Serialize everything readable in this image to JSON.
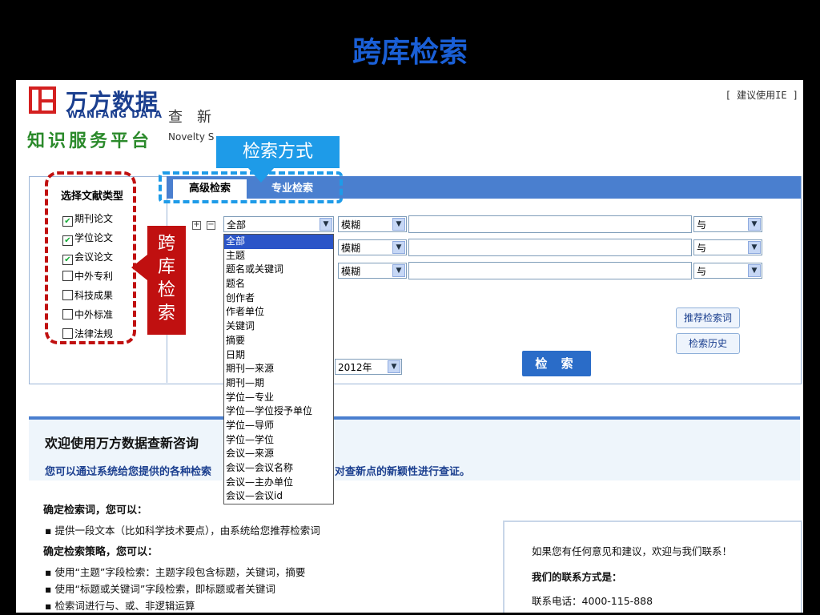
{
  "slide": {
    "title": "跨库检索"
  },
  "header": {
    "logo_cn": "万方数据",
    "logo_en": "WANFANG DATA",
    "platform": "知识服务平台",
    "product_cn": "查新",
    "product_en": "Novelty S",
    "suggest": "[ 建议使用IE ]"
  },
  "callouts": {
    "search_mode": "检索方式",
    "cross_db": [
      "跨",
      "库",
      "检",
      "索"
    ]
  },
  "tabs": [
    {
      "label": "高级检索"
    },
    {
      "label": "专业检索"
    }
  ],
  "doc_types": {
    "title": "选择文献类型",
    "items": [
      {
        "label": "期刊论文",
        "checked": true
      },
      {
        "label": "学位论文",
        "checked": true
      },
      {
        "label": "会议论文",
        "checked": true
      },
      {
        "label": "中外专利",
        "checked": false
      },
      {
        "label": "科技成果",
        "checked": false
      },
      {
        "label": "中外标准",
        "checked": false
      },
      {
        "label": "法律法规",
        "checked": false
      }
    ]
  },
  "search_rows": [
    {
      "field": "全部",
      "match": "模糊",
      "logic": "与"
    },
    {
      "field": "",
      "match": "模糊",
      "logic": "与"
    },
    {
      "field": "",
      "match": "模糊",
      "logic": "与"
    }
  ],
  "field_options": [
    "全部",
    "主题",
    "题名或关键词",
    "题名",
    "创作者",
    "作者单位",
    "关键词",
    "摘要",
    "日期",
    "期刊—来源",
    "期刊—期",
    "学位—专业",
    "学位—学位授予单位",
    "学位—导师",
    "学位—学位",
    "会议—来源",
    "会议—会议名称",
    "会议—主办单位",
    "会议—会议id"
  ],
  "year_select": "2012年",
  "buttons": {
    "recommend": "推荐检索词",
    "history": "检索历史",
    "search": "检 索"
  },
  "welcome": {
    "title": "欢迎使用万方数据查新咨询",
    "sub_left": "您可以通过系统给您提供的各种检索",
    "sub_right": "对查新点的新颖性进行查证。"
  },
  "guide": {
    "sec1": "确定检索词，您可以：",
    "sec1_items": [
      "提供一段文本（比如科学技术要点），由系统给您推荐检索词"
    ],
    "sec2": "确定检索策略，您可以：",
    "sec2_items": [
      "使用“主题”字段检索：主题字段包含标题，关键词，摘要",
      "使用“标题或关键词”字段检索，即标题或者关键词",
      "检索词进行与、或、非逻辑运算"
    ]
  },
  "contact": {
    "intro": "如果您有任何意见和建议，欢迎与我们联系！",
    "title": "我们的联系方式是：",
    "phone": "联系电话：4000-115-888"
  },
  "colors": {
    "accent": "#4a7fcf",
    "callout_blue": "#1e9be8",
    "callout_red": "#c01010",
    "logo_red": "#d42020",
    "platform_green": "#2b8a2b"
  }
}
